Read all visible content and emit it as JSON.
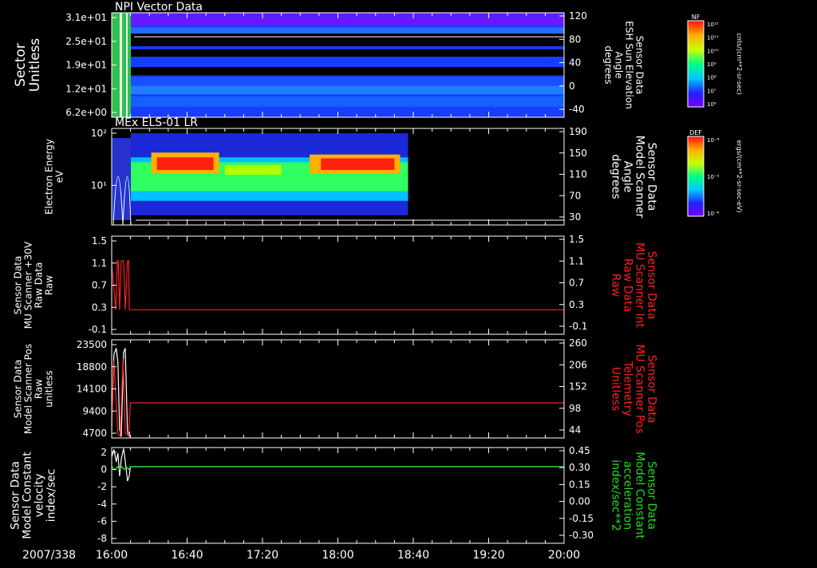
{
  "date_label": "2007/338",
  "x_ticks": [
    "16:00",
    "16:40",
    "17:20",
    "18:00",
    "18:40",
    "19:20",
    "20:00"
  ],
  "colors": {
    "white": "#ffffff",
    "red": "#ff2020",
    "green": "#22dd22",
    "background": "#000000"
  },
  "chart_data": [
    {
      "type": "heatmap",
      "title": "NPI Vector Data",
      "ylabel": [
        "Sector",
        "Unitless"
      ],
      "y_ticks": [
        "3.1e+01",
        "2.5e+01",
        "1.9e+01",
        "1.2e+01",
        "6.2e+00"
      ],
      "y2label": [
        "Sensor Data",
        "ESH Sun Elevation",
        "Angle",
        "degrees"
      ],
      "y2_ticks": [
        "120",
        "80",
        "40",
        "0",
        "-40"
      ],
      "y2lim": [
        -80,
        120
      ],
      "colorbar": {
        "label": "NF",
        "units": "cnts/(cm**2-sr-sec)",
        "ticks": [
          "10¹²",
          "10¹¹",
          "10¹⁰",
          "10⁹",
          "10⁸",
          "10⁷",
          "10⁶"
        ]
      }
    },
    {
      "type": "heatmap",
      "title": "MEx ELS-01 LR",
      "ylabel": [
        "Electron Energy",
        "eV"
      ],
      "y_ticks": [
        "10²",
        "10¹"
      ],
      "y2label": [
        "Sensor Data",
        "Model Scanner",
        "Angle",
        "degrees"
      ],
      "y2_ticks": [
        "190",
        "150",
        "110",
        "70",
        "30"
      ],
      "y2lim": [
        10,
        190
      ],
      "colorbar": {
        "label": "DEF",
        "units": "ergs/(cm**2-sr-sec-eV)",
        "ticks": [
          "10⁻⁴",
          "10⁻⁵",
          "10⁻⁶"
        ]
      }
    },
    {
      "type": "line",
      "ylabel": [
        "Sensor Data",
        "MU Scanner +30V",
        "Raw Data",
        "Raw"
      ],
      "y_ticks": [
        "1.5",
        "1.1",
        "0.7",
        "0.3",
        "-0.1"
      ],
      "ylim": [
        -0.5,
        1.5
      ],
      "y2label": [
        "Sensor Data",
        "MU Scanner Int",
        "Raw Data",
        "Raw"
      ],
      "y2_ticks": [
        "1.5",
        "1.1",
        "0.7",
        "0.3",
        "-0.1"
      ],
      "series": [
        {
          "color": "#ff2020",
          "x": [
            16.0,
            16.035,
            16.05,
            16.058,
            16.07,
            16.085,
            16.105,
            16.12,
            16.14,
            16.15,
            16.155,
            16.162,
            20.0
          ],
          "y": [
            0.95,
            0.0,
            1.0,
            1.0,
            0.0,
            1.0,
            1.0,
            0.0,
            1.0,
            1.0,
            0.0,
            0.0,
            0.0
          ]
        }
      ]
    },
    {
      "type": "line",
      "ylabel": [
        "Sensor Data",
        "Model Scanner Pos",
        "Raw",
        "unitless"
      ],
      "y_ticks": [
        "23500",
        "18800",
        "14100",
        "9400",
        "4700"
      ],
      "ylim": [
        0,
        23500
      ],
      "y2label": [
        "Sensor Data",
        "MU Scanner Pos",
        "Telemetry",
        "Unitless"
      ],
      "y2_ticks": [
        "260",
        "206",
        "152",
        "98",
        "44"
      ],
      "series": [
        {
          "color": "#ffffff",
          "x": [
            16.0,
            16.02,
            16.04,
            16.055,
            16.07,
            16.085,
            16.105,
            16.12,
            16.14,
            16.155,
            16.16
          ],
          "y": [
            3000,
            20000,
            21500,
            18000,
            2000,
            300,
            20500,
            21500,
            1500,
            300,
            1500
          ]
        },
        {
          "color": "#ff2020",
          "x": [
            16.0,
            16.02,
            16.055,
            16.075,
            16.1,
            16.12,
            16.15,
            16.165,
            20.0
          ],
          "y": [
            1500,
            18500,
            1000,
            400,
            19000,
            1200,
            400,
            8400,
            8400
          ]
        }
      ]
    },
    {
      "type": "line",
      "ylabel": [
        "Sensor Data",
        "Model Constant",
        "velocity",
        "index/sec"
      ],
      "y_ticks": [
        "2",
        "0",
        "-2",
        "-4",
        "-6",
        "-8"
      ],
      "ylim": [
        -8,
        2
      ],
      "y2label": [
        "Sensor Data",
        "Model Constant",
        "acceleration",
        "index/sec**2"
      ],
      "y2_ticks": [
        "0.45",
        "0.30",
        "0.15",
        "0.00",
        "-0.15",
        "-0.30"
      ],
      "y2lim": [
        -0.3,
        0.45
      ],
      "series": [
        {
          "color": "#ffffff",
          "x": [
            16.0,
            16.02,
            16.04,
            16.055,
            16.07,
            16.085,
            16.105,
            16.12,
            16.14,
            16.155,
            16.165,
            20.0
          ],
          "y": [
            1.0,
            1.8,
            0.5,
            1.4,
            -1.0,
            0.8,
            1.9,
            0.6,
            -1.5,
            -1.0,
            0.0,
            0.0
          ]
        },
        {
          "color": "#22dd22",
          "x": [
            16.0,
            16.03,
            16.05,
            16.07,
            16.09,
            16.11,
            16.13,
            16.15,
            16.165,
            20.0
          ],
          "y": [
            0.0,
            -0.3,
            0.0,
            -0.3,
            0.0,
            -0.3,
            0.0,
            -0.3,
            0.0,
            0.0
          ]
        }
      ]
    }
  ]
}
